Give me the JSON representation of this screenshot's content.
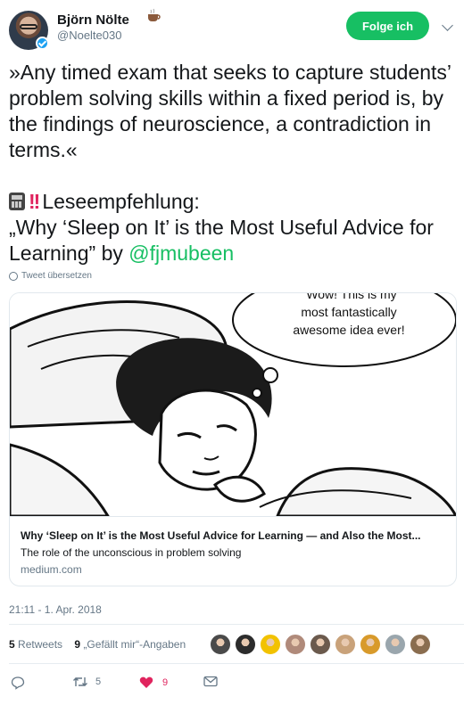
{
  "author": {
    "name": "Björn Nölte",
    "handle": "@Noelte030",
    "emoji": "coffee-icon"
  },
  "follow_button": "Folge ich",
  "tweet": {
    "quote": "»Any timed exam that seeks to capture students’ problem solving skills within a fixed period is, by the findings of neuroscience, a contradiction in terms.«",
    "reco_label": "Leseempfehlung:",
    "reco_title": "„Why ‘Sleep on It’ is the Most Useful Advice for Learning” by",
    "mention": "@fjmubeen"
  },
  "translate_label": "Tweet übersetzen",
  "card": {
    "bubble_line1": "Wow! This is my",
    "bubble_line2": "most fantastically",
    "bubble_line3": "awesome idea ever!",
    "title": "Why ‘Sleep on It’ is the Most Useful Advice for Learning — and Also the Most...",
    "description": "The role of the unconscious in problem solving",
    "domain": "medium.com"
  },
  "timestamp": "21:11 - 1. Apr. 2018",
  "stats": {
    "retweets_count": "5",
    "retweets_label": "Retweets",
    "likes_count": "9",
    "likes_label": "„Gefällt mir“-Angaben"
  },
  "likers": [
    "#4a4a4a",
    "#2c2c2c",
    "#f2c200",
    "#b08a7a",
    "#6b5a4d",
    "#c9a27a",
    "#d89a2b",
    "#9aa6ad",
    "#8a6d4f"
  ],
  "actions": {
    "reply_icon": "reply-icon",
    "retweet_count": "5",
    "like_count": "9",
    "dm_icon": "envelope-icon"
  },
  "colors": {
    "accent_green": "#17bf63",
    "like_red": "#e0245e",
    "muted": "#657786"
  }
}
